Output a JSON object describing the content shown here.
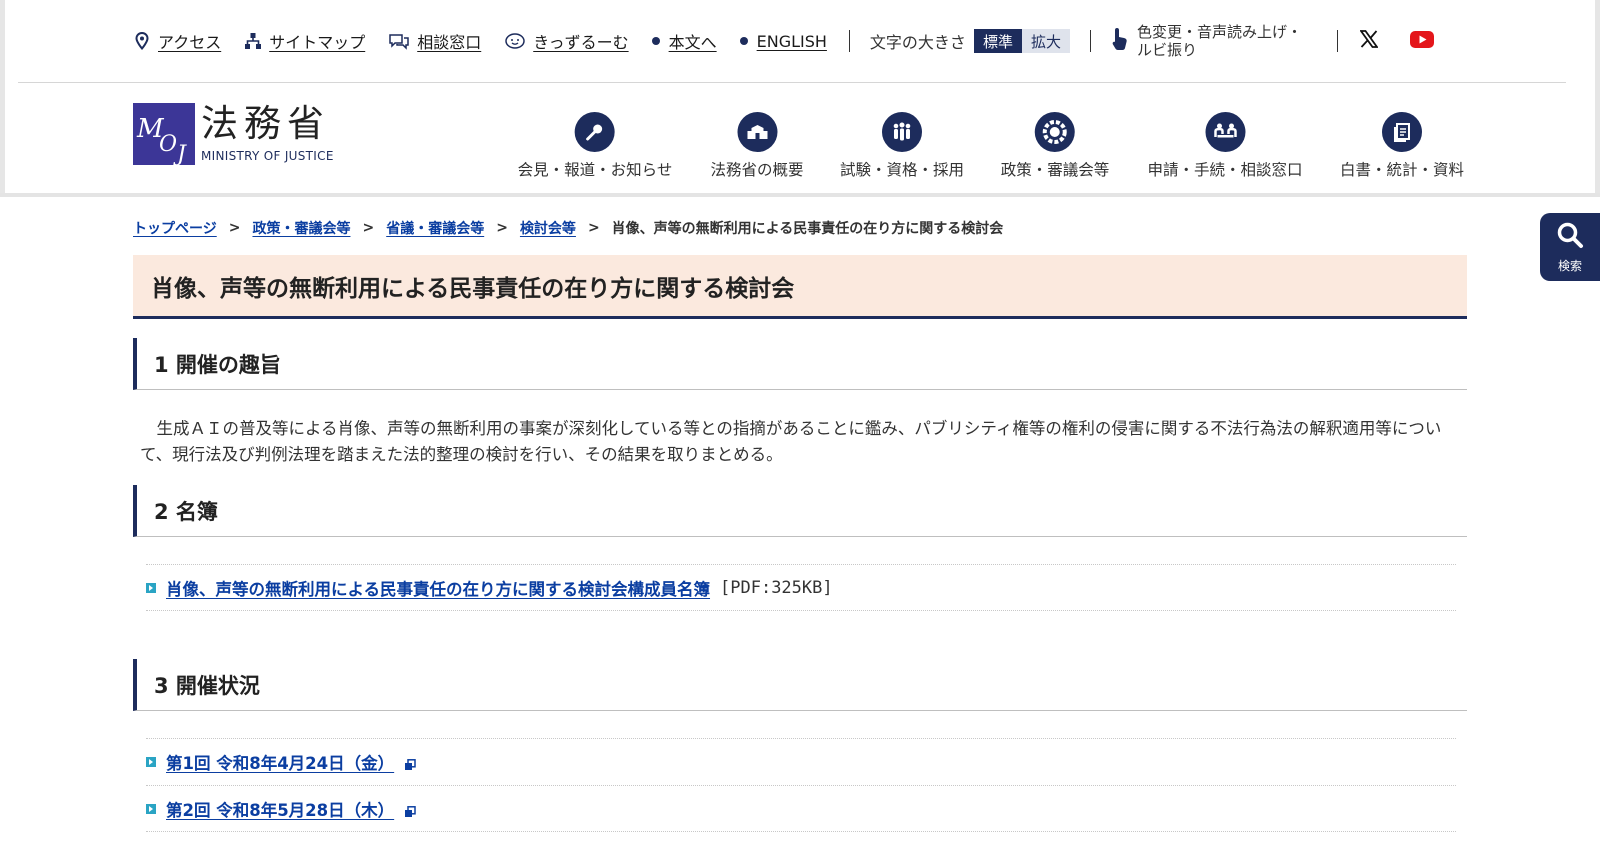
{
  "utility": {
    "access": "アクセス",
    "sitemap": "サイトマップ",
    "consult": "相談窓口",
    "kids": "きっずるーむ",
    "to_body": "本文へ",
    "english": "ENGLISH",
    "font_size_label": "文字の大きさ",
    "font_standard": "標準",
    "font_large": "拡大",
    "accessibility": "色変更・音声読み上げ・ルビ振り"
  },
  "logo": {
    "jp": "法務省",
    "en": "MINISTRY OF JUSTICE"
  },
  "nav": [
    {
      "label": "会見・報道・お知らせ",
      "icon": "microphone-icon"
    },
    {
      "label": "法務省の概要",
      "icon": "building-icon"
    },
    {
      "label": "試験・資格・採用",
      "icon": "people-icon"
    },
    {
      "label": "政策・審議会等",
      "icon": "gear-circle-icon"
    },
    {
      "label": "申請・手続・相談窓口",
      "icon": "consultation-icon"
    },
    {
      "label": "白書・統計・資料",
      "icon": "document-icon"
    }
  ],
  "breadcrumb": {
    "items": [
      "トップページ",
      "政策・審議会等",
      "省議・審議会等",
      "検討会等"
    ],
    "separator": ">",
    "current": "肖像、声等の無断利用による民事責任の在り方に関する検討会"
  },
  "search_tab": {
    "label": "検索"
  },
  "page": {
    "title": "肖像、声等の無断利用による民事責任の在り方に関する検討会",
    "sections": [
      {
        "heading": "1 開催の趣旨",
        "body": "生成ＡＩの普及等による肖像、声等の無断利用の事案が深刻化している等との指摘があることに鑑み、パブリシティ権等の権利の侵害に関する不法行為法の解釈適用等について、現行法及び判例法理を踏まえた法的整理の検討を行い、その結果を取りまとめる。"
      },
      {
        "heading": "2 名簿",
        "links": [
          {
            "text": "肖像、声等の無断利用による民事責任の在り方に関する検討会構成員名簿",
            "meta": "[PDF:325KB]"
          }
        ]
      },
      {
        "heading": "3 開催状況",
        "links": [
          {
            "text": "第1回 令和8年4月24日（金）"
          },
          {
            "text": "第2回 令和8年5月28日（木）"
          }
        ]
      }
    ]
  },
  "colors": {
    "navy": "#1d2c5c",
    "title_bg": "#fbe9de",
    "link": "#0b3ea1",
    "bullet": "#2aa4c4",
    "logo_purple": "#3c3697",
    "youtube_red": "#e4161b"
  }
}
